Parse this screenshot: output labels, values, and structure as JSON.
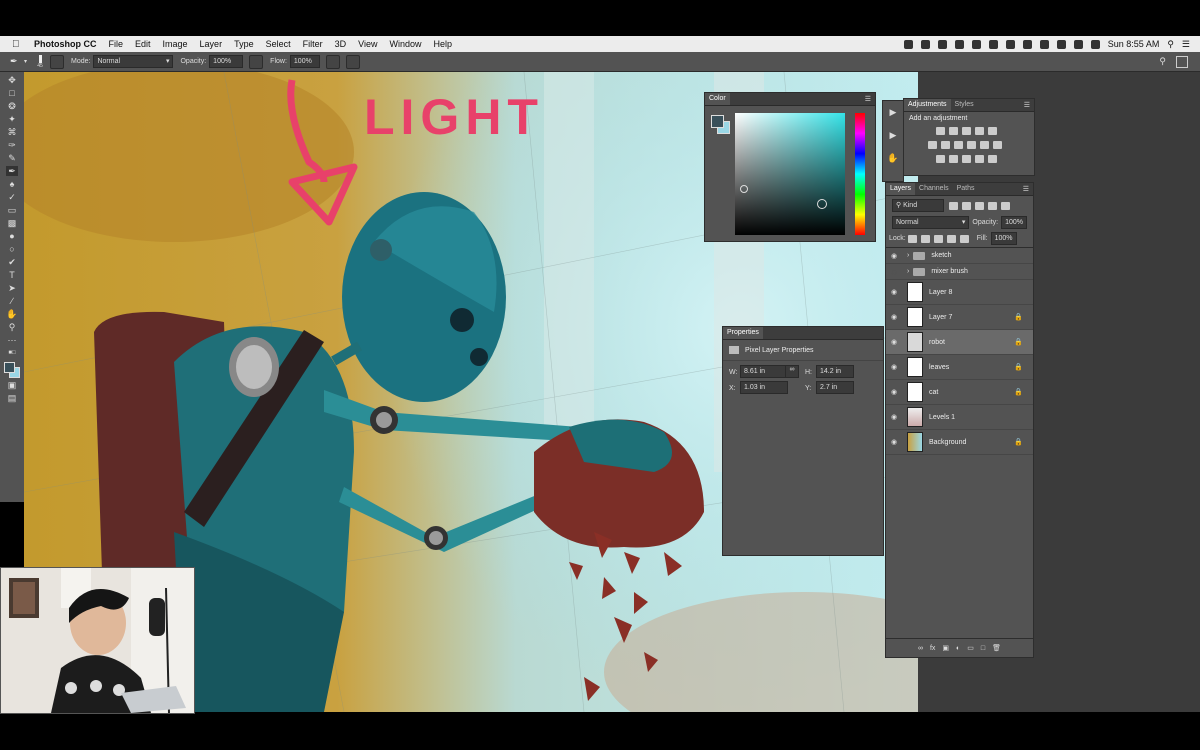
{
  "menubar": {
    "app_name": "Photoshop CC",
    "items": [
      "File",
      "Edit",
      "Image",
      "Layer",
      "Type",
      "Select",
      "Filter",
      "3D",
      "View",
      "Window",
      "Help"
    ],
    "clock": "Sun 8:55 AM"
  },
  "options": {
    "brush_size": "45",
    "mode_label": "Mode:",
    "mode_value": "Normal",
    "opacity_label": "Opacity:",
    "opacity_value": "100%",
    "flow_label": "Flow:",
    "flow_value": "100%"
  },
  "canvas": {
    "annotation_text": "LIGHT",
    "annotation_color": "#e8416a"
  },
  "color_panel": {
    "tab": "Color"
  },
  "adjustments_panel": {
    "tabs": [
      "Adjustments",
      "Styles"
    ],
    "hint": "Add an adjustment"
  },
  "properties_panel": {
    "tab": "Properties",
    "title": "Pixel Layer Properties",
    "w_label": "W:",
    "w_value": "8.61 in",
    "h_label": "H:",
    "h_value": "14.2 in",
    "x_label": "X:",
    "x_value": "1.03 in",
    "y_label": "Y:",
    "y_value": "2.7 in"
  },
  "layers_panel": {
    "tabs": [
      "Layers",
      "Channels",
      "Paths"
    ],
    "filter_label": "Kind",
    "blend_mode": "Normal",
    "opacity_label": "Opacity:",
    "opacity_value": "100%",
    "lock_label": "Lock:",
    "fill_label": "Fill:",
    "fill_value": "100%",
    "layers": [
      {
        "name": "sketch",
        "type": "group"
      },
      {
        "name": "mixer brush",
        "type": "group"
      },
      {
        "name": "Layer 8",
        "type": "pixel"
      },
      {
        "name": "Layer 7",
        "type": "pixel"
      },
      {
        "name": "robot",
        "type": "pixel",
        "selected": true
      },
      {
        "name": "leaves",
        "type": "pixel"
      },
      {
        "name": "cat",
        "type": "pixel"
      },
      {
        "name": "Levels 1",
        "type": "adjustment"
      },
      {
        "name": "Background",
        "type": "pixel"
      }
    ]
  }
}
